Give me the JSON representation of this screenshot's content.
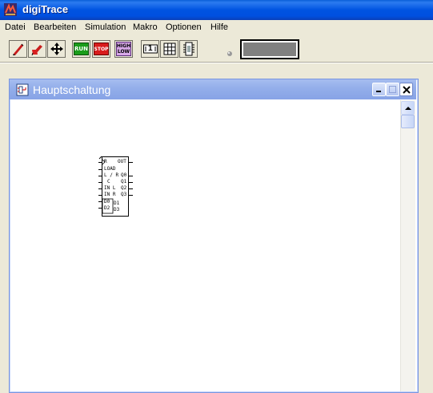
{
  "window": {
    "title": "digiTrace",
    "icon": "app-icon"
  },
  "menu": {
    "items": [
      {
        "label": "Datei"
      },
      {
        "label": "Bearbeiten"
      },
      {
        "label": "Simulation"
      },
      {
        "label": "Makro"
      },
      {
        "label": "Optionen"
      },
      {
        "label": "Hilfe"
      }
    ]
  },
  "toolbar": {
    "run_label": "RUN",
    "stop_label": "STOP",
    "high_label": "HIGH",
    "low_label": "LOW",
    "counter_label": "1",
    "speed_icon": "speed-indicator-icon",
    "status_display_color": "#808080"
  },
  "child": {
    "title": "Hauptschaltung",
    "component": {
      "left_pins": [
        "R",
        "LOAD",
        "L / R",
        "C",
        "IN L",
        "IN R",
        "D0",
        "D2"
      ],
      "right_pins": [
        "OUT",
        "Q0",
        "Q1",
        "Q2",
        "Q3",
        "D1",
        "D3"
      ]
    }
  },
  "colors": {
    "title_blue": "#0053e1",
    "child_title": "#93aeea",
    "run_green": "#1a9c1a",
    "stop_red": "#d81c1c"
  }
}
